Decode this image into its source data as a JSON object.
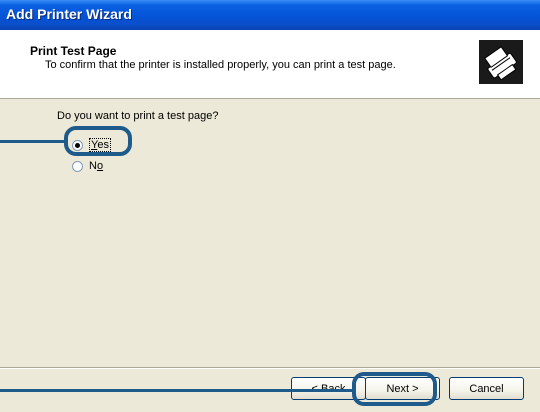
{
  "window": {
    "title": "Add Printer Wizard"
  },
  "header": {
    "title": "Print Test Page",
    "subtitle": "To confirm that the printer is installed properly, you can print a test page.",
    "icon": "printer-icon"
  },
  "question": "Do you want to print a test page?",
  "options": [
    {
      "label": "Yes",
      "mnemonic": "Y",
      "selected": true
    },
    {
      "label": "No",
      "mnemonic": "o",
      "selected": false
    }
  ],
  "buttons": {
    "back": "< Back",
    "next": "Next >",
    "cancel": "Cancel"
  },
  "colors": {
    "titlebar": "#0454d6",
    "callout": "#1f5b8a",
    "dialog_bg": "#ece9d8"
  }
}
